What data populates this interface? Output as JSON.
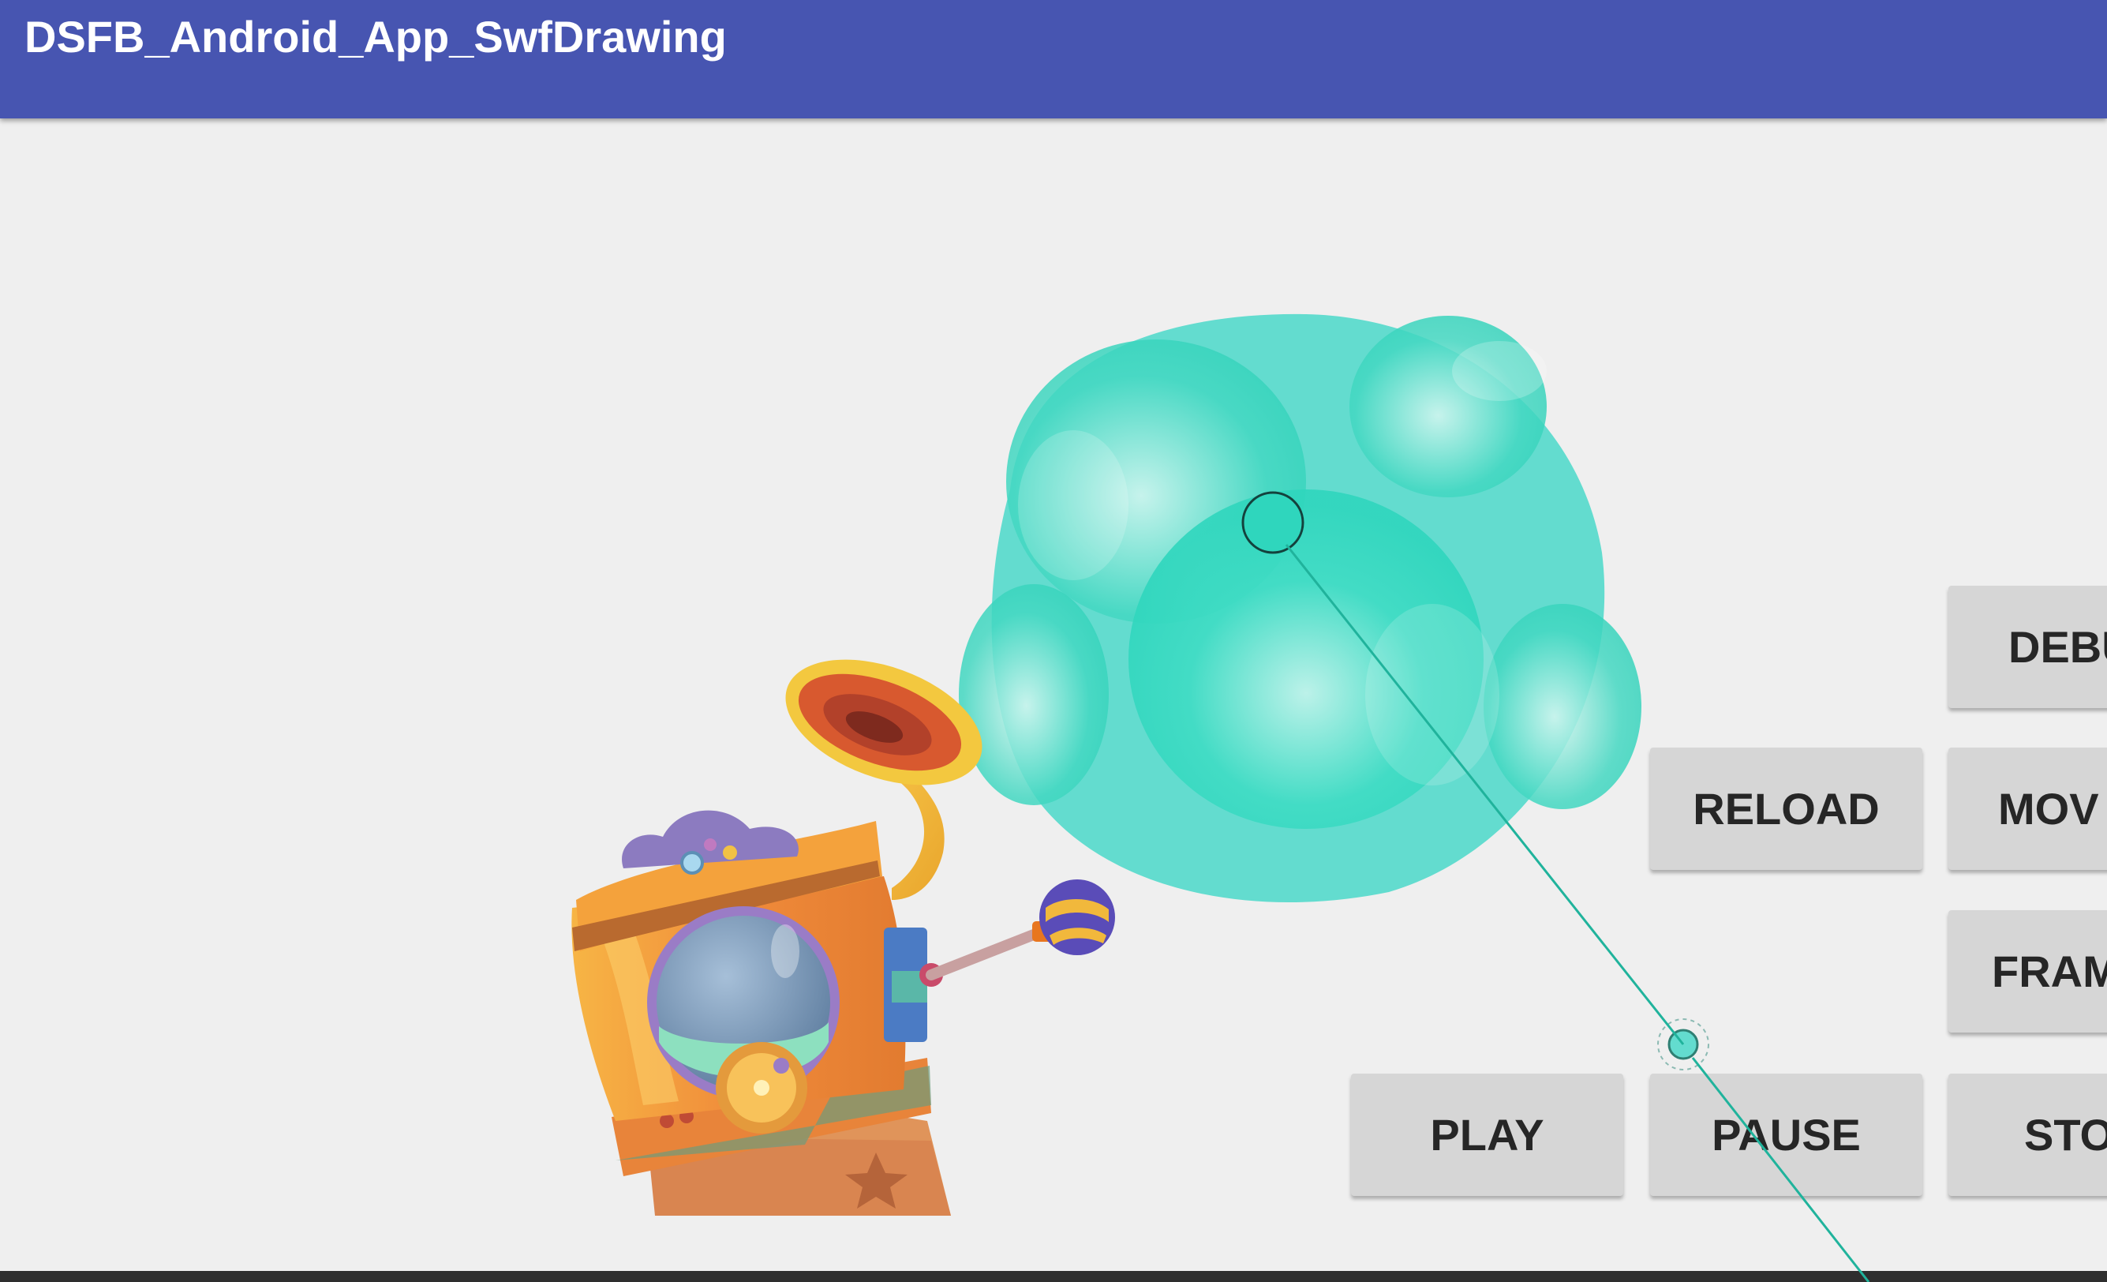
{
  "app": {
    "title": "DSFB_Android_App_SwfDrawing"
  },
  "buttons": {
    "debug": "DEBU",
    "reload": "RELOAD",
    "move": "MOV",
    "frame": "FRAM",
    "play": "PLAY",
    "pause": "PAUSE",
    "stop": "STO"
  },
  "colors": {
    "appbar": "#4755b1",
    "background": "#efefef",
    "button": "#d6d6d6",
    "bubble": "#63dccf",
    "line": "#20b39c"
  },
  "icons": {
    "artwork": "gramophone-machine-illustration",
    "bubble": "teal-bubble-illustration"
  }
}
